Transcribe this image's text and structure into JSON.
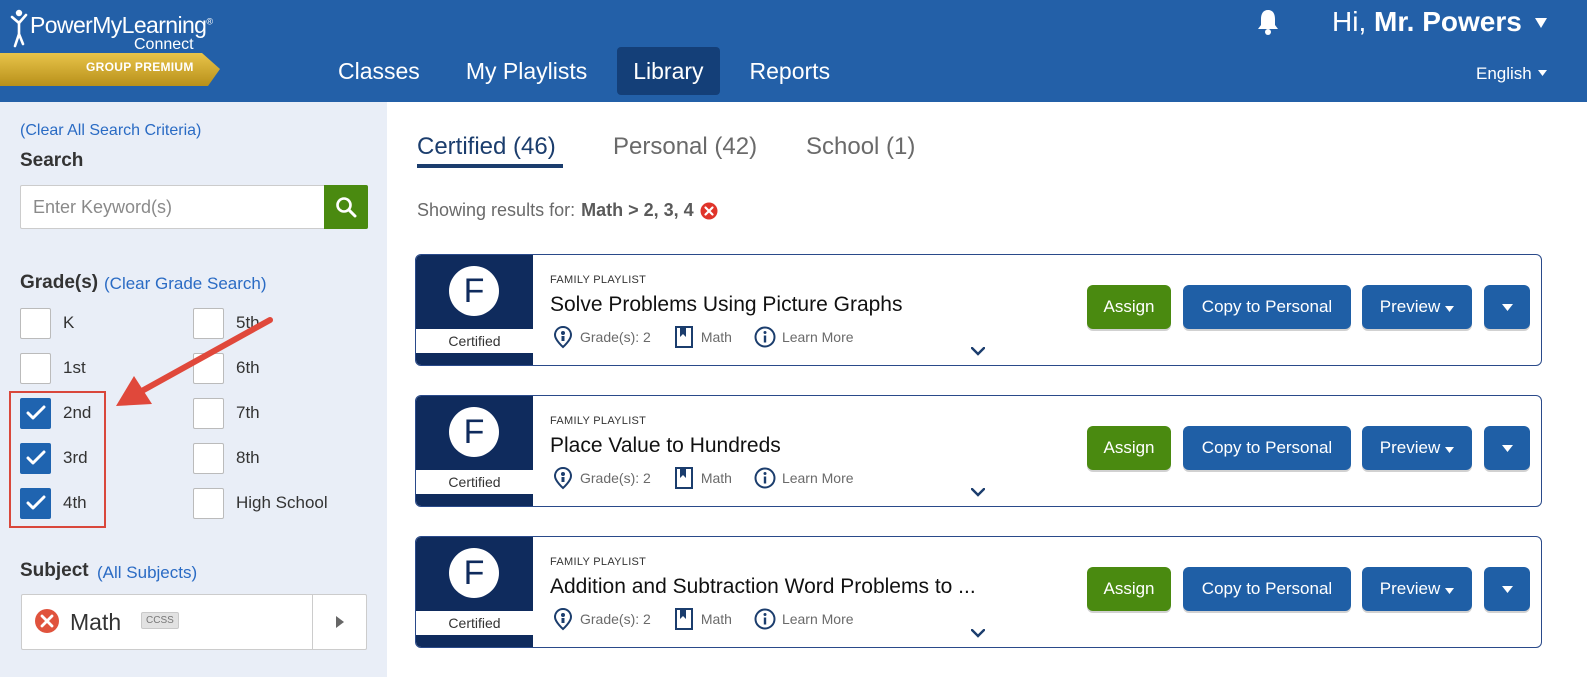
{
  "header": {
    "brand": "PowerMyLearning",
    "brand_mark": "®",
    "brand_sub": "Connect",
    "tier": "GROUP PREMIUM",
    "nav": [
      {
        "label": "Classes",
        "active": false
      },
      {
        "label": "My Playlists",
        "active": false
      },
      {
        "label": "Library",
        "active": true
      },
      {
        "label": "Reports",
        "active": false
      }
    ],
    "greeting_prefix": "Hi, ",
    "user_name": "Mr. Powers",
    "language": "English"
  },
  "sidebar": {
    "clear_all": "(Clear All Search Criteria)",
    "search_label": "Search",
    "search_placeholder": "Enter Keyword(s)",
    "search_value": "",
    "grades_label": "Grade(s)",
    "clear_grade": "(Clear Grade Search)",
    "grades_col1": [
      {
        "label": "K",
        "checked": false
      },
      {
        "label": "1st",
        "checked": false
      },
      {
        "label": "2nd",
        "checked": true
      },
      {
        "label": "3rd",
        "checked": true
      },
      {
        "label": "4th",
        "checked": true
      }
    ],
    "grades_col2": [
      {
        "label": "5th",
        "checked": false
      },
      {
        "label": "6th",
        "checked": false
      },
      {
        "label": "7th",
        "checked": false
      },
      {
        "label": "8th",
        "checked": false
      },
      {
        "label": "High School",
        "checked": false
      }
    ],
    "subject_label": "Subject",
    "all_subjects": "(All Subjects)",
    "subject_value": "Math",
    "subject_tag": "CCSS"
  },
  "main": {
    "tabs": [
      {
        "label": "Certified (46)",
        "active": true
      },
      {
        "label": "Personal (42)",
        "active": false
      },
      {
        "label": "School (1)",
        "active": false
      }
    ],
    "results_prefix": "Showing results for:",
    "results_filter": "Math > 2,  3,  4",
    "cards": [
      {
        "badge_letter": "F",
        "badge_label": "Certified",
        "type": "FAMILY PLAYLIST",
        "title": "Solve Problems Using Picture Graphs",
        "grades": "Grade(s): 2",
        "subject": "Math",
        "learn_more": "Learn More"
      },
      {
        "badge_letter": "F",
        "badge_label": "Certified",
        "type": "FAMILY PLAYLIST",
        "title": "Place Value to Hundreds",
        "grades": "Grade(s): 2",
        "subject": "Math",
        "learn_more": "Learn More"
      },
      {
        "badge_letter": "F",
        "badge_label": "Certified",
        "type": "FAMILY PLAYLIST",
        "title": "Addition and Subtraction Word Problems to ...",
        "grades": "Grade(s): 2",
        "subject": "Math",
        "learn_more": "Learn More"
      }
    ],
    "buttons": {
      "assign": "Assign",
      "copy": "Copy to Personal",
      "preview": "Preview"
    }
  },
  "colors": {
    "header_bg": "#2360a8",
    "nav_active": "#143f78",
    "sidebar_bg": "#e9eef7",
    "green": "#4a8a10",
    "blue_button": "#1f5fa6",
    "navy_badge": "#0f2b5d",
    "link": "#2a6bc4",
    "highlight": "#d9473b"
  }
}
